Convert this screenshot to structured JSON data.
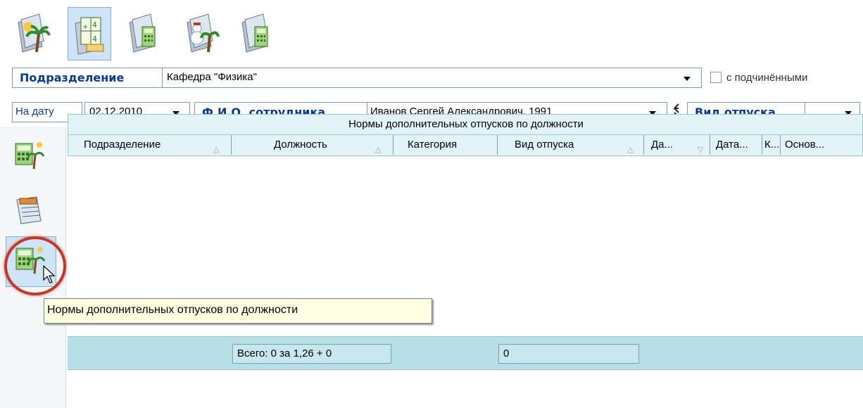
{
  "toolbar": {
    "buttons": [
      {
        "icon": "vacation-palm-icon"
      },
      {
        "icon": "calculator-table-icon"
      },
      {
        "icon": "document-calculator-icon"
      },
      {
        "icon": "snowman-palm-icon"
      },
      {
        "icon": "document-calculator-icon-2"
      }
    ]
  },
  "filters": {
    "department_label": "Подразделение",
    "department_value": "Кафедра \"Физика\"",
    "subordinates_label": "с подчинёнными",
    "date_label": "На дату",
    "date_value": "02.12.2010",
    "employee_label": "Ф.И.О. сотрудника",
    "employee_value": "Иванов Сергей Александрович, 1991",
    "vacation_type_label": "Вид отпуска",
    "vacation_type_value": ""
  },
  "grid": {
    "title": "Нормы дополнительных отпусков по должности",
    "columns": [
      "Подразделение",
      "Должность",
      "Категория",
      "Вид отпуска",
      "Да...",
      "Дата...",
      "К...",
      "Основ..."
    ],
    "rows": []
  },
  "tooltip": {
    "text": "Нормы дополнительных отпусков по должности"
  },
  "footer": {
    "total_text": "Всего: 0 за 1,26 + 0",
    "count_value": "0"
  },
  "colors": {
    "accent": "#0b3a8c",
    "grid_header": "#e3f4f8",
    "footer_bar": "#b7dfe8",
    "highlight_ring": "#c0392b"
  }
}
